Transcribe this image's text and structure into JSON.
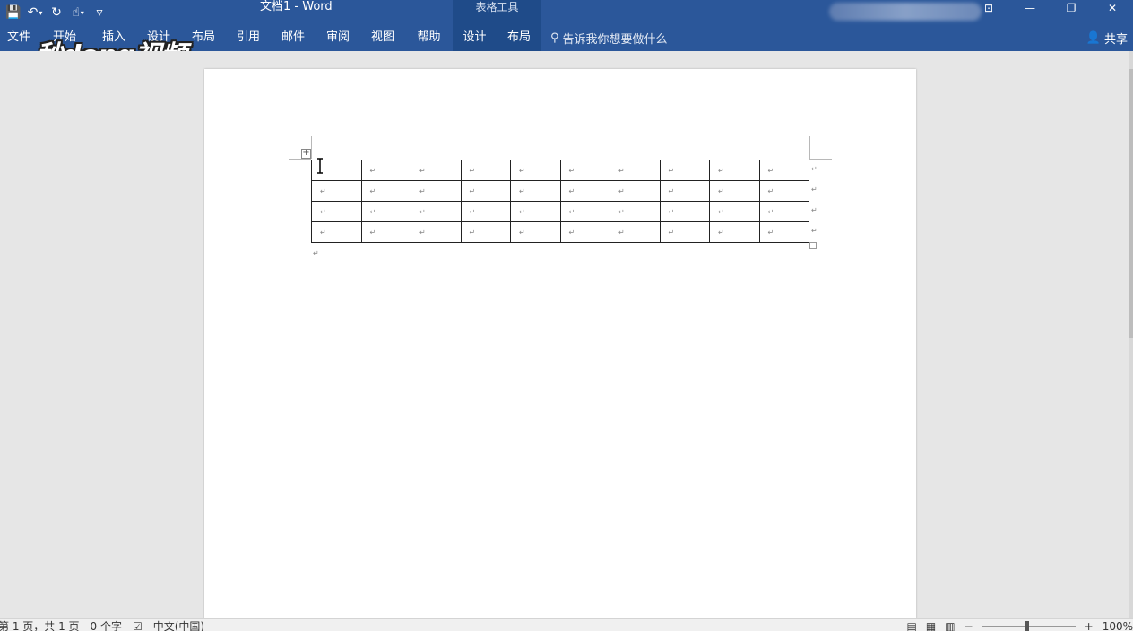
{
  "titlebar": {
    "doc_title": "文档1  -  Word",
    "contextual_title": "表格工具",
    "qat": {
      "save_icon": "💾",
      "undo_icon": "↶",
      "redo_icon": "↻",
      "touch_icon": "☝",
      "dropdown_glyph": "▾",
      "customize_glyph": "▿"
    },
    "window": {
      "ribbon_display": "⊡",
      "minimize": "—",
      "restore": "❐",
      "close": "✕"
    }
  },
  "ribbon": {
    "tabs": [
      "文件",
      "开始",
      "插入",
      "设计",
      "布局",
      "引用",
      "邮件",
      "审阅",
      "视图",
      "帮助",
      "设计",
      "布局"
    ],
    "search_icon": "⚲",
    "search_text": "告诉我你想要做什么",
    "share_icon": "👤",
    "share_label": "共享"
  },
  "watermark": {
    "text": "秒dong视频"
  },
  "document": {
    "table": {
      "rows": 4,
      "cols": 10,
      "cell_mark": "↵"
    },
    "paragraph_mark": "↵",
    "move_handle_glyph": "+"
  },
  "statusbar": {
    "page": "第 1 页，共 1 页",
    "words": "0 个字",
    "proofing_icon": "☑",
    "language": "中文(中国)",
    "read_mode_icon": "▤",
    "print_layout_icon": "▦",
    "web_layout_icon": "▥",
    "zoom_out": "−",
    "zoom_in": "+",
    "zoom": "100%"
  }
}
